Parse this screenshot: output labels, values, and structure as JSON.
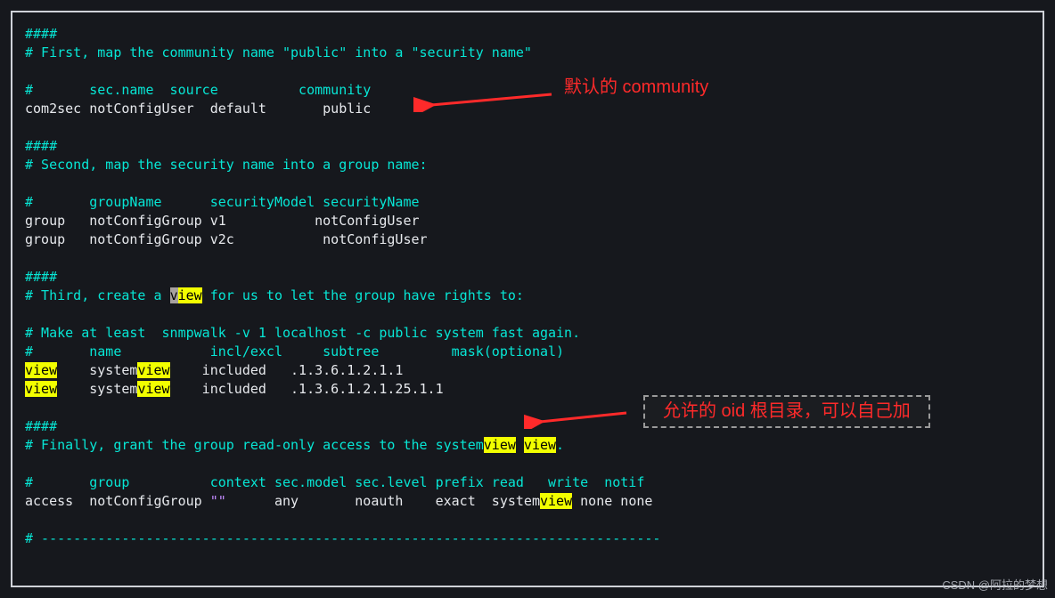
{
  "code": {
    "l1": "####",
    "l2": "# First, map the community name \"public\" into a \"security name\"",
    "l3": "",
    "l4": "#       sec.name  source          community",
    "l5": "com2sec notConfigUser  default       public",
    "l6": "",
    "l7": "####",
    "l8": "# Second, map the security name into a group name:",
    "l9": "",
    "l10": "#       groupName      securityModel securityName",
    "l11": "group   notConfigGroup v1           notConfigUser",
    "l12": "group   notConfigGroup v2c           notConfigUser",
    "l13": "",
    "l14": "####",
    "l15a": "# Third, create a ",
    "l15b_first": "v",
    "l15b_rest": "iew",
    "l15c": " for us to let the group have rights to:",
    "l16": "",
    "l17": "# Make at least  snmpwalk -v 1 localhost -c public system fast again.",
    "l18": "#       name           incl/excl     subtree         mask(optional)",
    "l19a": "view",
    "l19b": "    system",
    "l19c": "view",
    "l19d": "    included   .1.3.6.1.2.1.1",
    "l20a": "view",
    "l20b": "    system",
    "l20c": "view",
    "l20d": "    included   .1.3.6.1.2.1.25.1.1",
    "l21": "",
    "l22": "####",
    "l23a": "# Finally, grant the group read-only access to the system",
    "l23b": "view",
    "l23c": " ",
    "l23d": "view",
    "l23e": ".",
    "l24": "",
    "l25": "#       group          context sec.model sec.level prefix read   write  notif",
    "l26a": "access  notConfigGroup ",
    "l26b": "\"\"",
    "l26c": "      any       noauth    exact  system",
    "l26d": "view",
    "l26e": " none none",
    "l27": "",
    "l28": "# -----------------------------------------------------------------------------"
  },
  "annotations": {
    "a1": "默认的 community",
    "a2": "允许的 oid 根目录，可以自己加"
  },
  "watermark": "CSDN @阿拉的梦想"
}
